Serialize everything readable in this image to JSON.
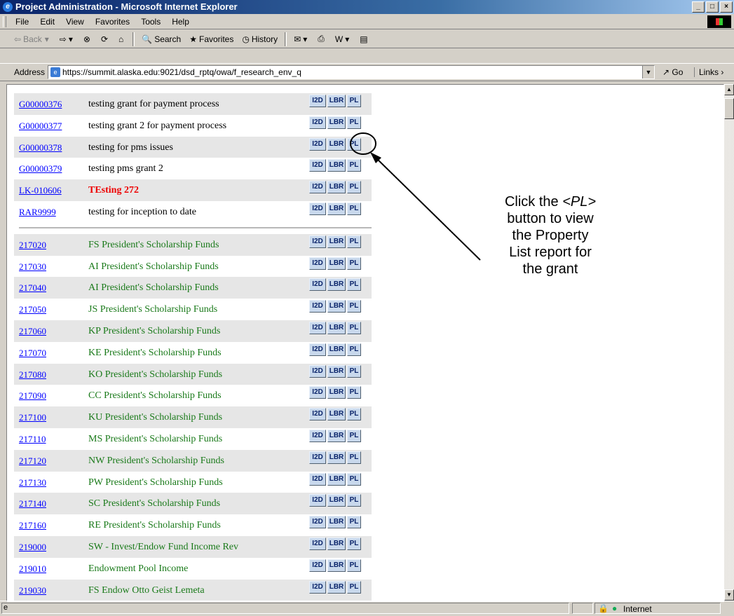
{
  "window": {
    "title": "Project Administration - Microsoft Internet Explorer",
    "buttons": [
      "_",
      "□",
      "×"
    ]
  },
  "menubar": [
    "File",
    "Edit",
    "View",
    "Favorites",
    "Tools",
    "Help"
  ],
  "toolbar": {
    "back": "Back",
    "search": "Search",
    "favorites": "Favorites",
    "history": "History"
  },
  "address": {
    "label": "Address",
    "url": "https://summit.alaska.edu:9021/dsd_rptq/owa/f_research_env_q",
    "go": "Go",
    "links": "Links"
  },
  "row_buttons": {
    "i2d": "I2D",
    "lbr": "LBR",
    "pl": "PL"
  },
  "grants": [
    {
      "code": "G00000376",
      "desc": "testing grant for payment process",
      "style": "normal"
    },
    {
      "code": "G00000377",
      "desc": "testing grant 2 for payment process",
      "style": "normal"
    },
    {
      "code": "G00000378",
      "desc": "testing for pms issues",
      "style": "normal"
    },
    {
      "code": "G00000379",
      "desc": "testing pms grant 2",
      "style": "normal"
    },
    {
      "code": "LK-010606",
      "desc": "TEsting 272",
      "style": "red"
    },
    {
      "code": "RAR9999",
      "desc": "testing for inception to date",
      "style": "normal"
    }
  ],
  "funds": [
    {
      "code": "217020",
      "desc": "FS President's Scholarship Funds"
    },
    {
      "code": "217030",
      "desc": "AI President's Scholarship Funds"
    },
    {
      "code": "217040",
      "desc": "AI President's Scholarship Funds"
    },
    {
      "code": "217050",
      "desc": "JS President's Scholarship Funds"
    },
    {
      "code": "217060",
      "desc": "KP President's Scholarship Funds"
    },
    {
      "code": "217070",
      "desc": "KE President's Scholarship Funds"
    },
    {
      "code": "217080",
      "desc": "KO President's Scholarship Funds"
    },
    {
      "code": "217090",
      "desc": "CC President's Scholarship Funds"
    },
    {
      "code": "217100",
      "desc": "KU President's Scholarship Funds"
    },
    {
      "code": "217110",
      "desc": "MS President's Scholarship Funds"
    },
    {
      "code": "217120",
      "desc": "NW President's Scholarship Funds"
    },
    {
      "code": "217130",
      "desc": "PW President's Scholarship Funds"
    },
    {
      "code": "217140",
      "desc": "SC President's Scholarship Funds"
    },
    {
      "code": "217160",
      "desc": "RE President's Scholarship Funds"
    },
    {
      "code": "219000",
      "desc": "SW - Invest/Endow Fund Income Rev"
    },
    {
      "code": "219010",
      "desc": "Endowment Pool Income"
    },
    {
      "code": "219030",
      "desc": "FS Endow Otto Geist Lemeta"
    }
  ],
  "callout": {
    "line1_prefix": "Click the ",
    "line1_em": "<PL>",
    "line2": "button to view",
    "line3": "the Property",
    "line4": "List report for",
    "line5": "the grant"
  },
  "status": {
    "zone": "Internet"
  }
}
